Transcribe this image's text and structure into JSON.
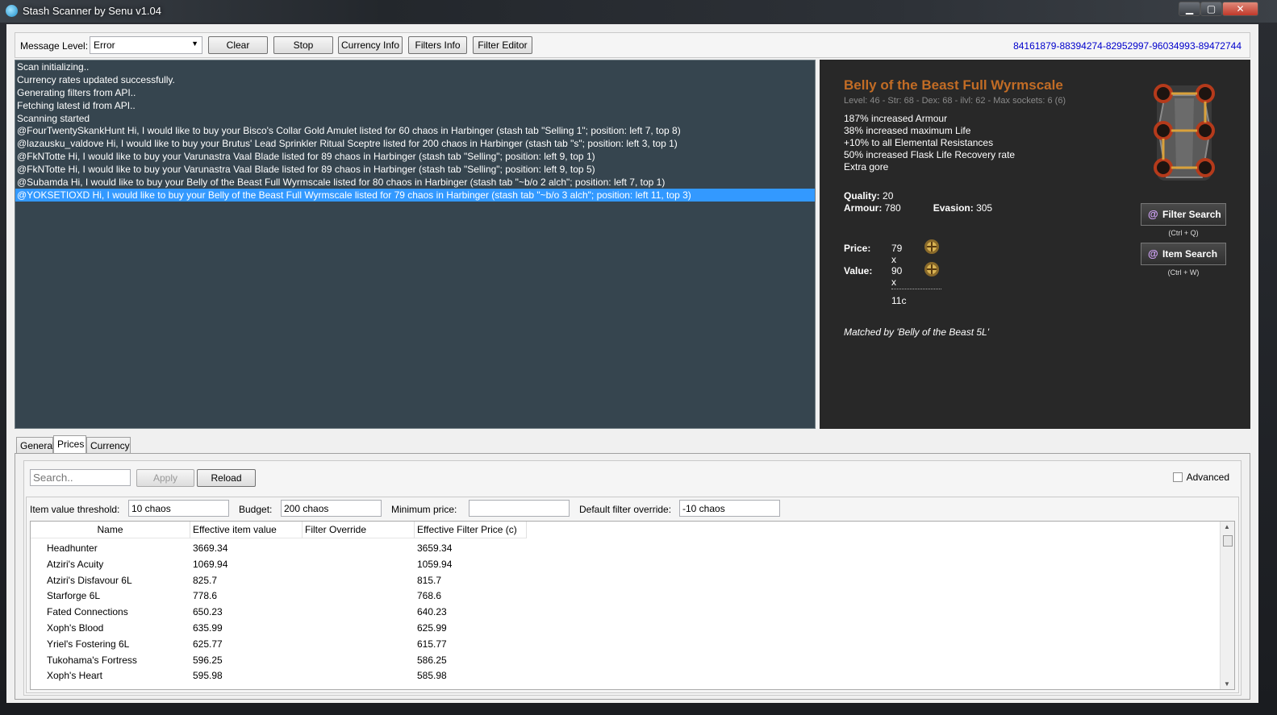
{
  "window": {
    "title": "Stash Scanner by Senu v1.04",
    "minimize": "▁",
    "maximize": "▢",
    "close": "✕"
  },
  "toolbar": {
    "message_level_label": "Message Level:",
    "message_level_value": "Error",
    "clear_label": "Clear",
    "stop_label": "Stop",
    "currency_info_label": "Currency Info",
    "filters_info_label": "Filters Info",
    "filter_editor_label": "Filter Editor",
    "change_id": "84161879-88394274-82952997-96034993-89472744"
  },
  "log": {
    "lines": [
      "Scan initializing..",
      "Currency rates updated successfully.",
      "Generating filters from API..",
      "Fetching latest id from API..",
      "Scanning started",
      "@FourTwentySkankHunt Hi, I would like to buy your Bisco's Collar Gold Amulet listed for 60 chaos in Harbinger (stash tab \"Selling 1\"; position: left 7, top 8)",
      "@lazausku_valdove Hi, I would like to buy your Brutus' Lead Sprinkler Ritual Sceptre listed for 200 chaos in Harbinger (stash tab \"s\"; position: left 3, top 1)",
      "@FkNTotte Hi, I would like to buy your Varunastra Vaal Blade listed for 89 chaos in Harbinger (stash tab \"Selling\"; position: left 9, top 1)",
      "@FkNTotte Hi, I would like to buy your Varunastra Vaal Blade listed for 89 chaos in Harbinger (stash tab \"Selling\"; position: left 9, top 5)",
      "@Subamda Hi, I would like to buy your Belly of the Beast Full Wyrmscale listed for 80 chaos in Harbinger (stash tab \"~b/o 2 alch\"; position: left 7, top 1)",
      "@YOKSETIOXD Hi, I would like to buy your Belly of the Beast Full Wyrmscale listed for 79 chaos in Harbinger (stash tab \"~b/o 3 alch\"; position: left 11, top 3)"
    ]
  },
  "item": {
    "name": "Belly of the Beast Full Wyrmscale",
    "name_color": "#c26c25",
    "meta": "Level: 46 - Str: 68 - Dex: 68 - ilvl: 62 - Max sockets: 6 (6)",
    "mods": [
      "187% increased Armour",
      "38% increased maximum Life",
      "+10% to all Elemental Resistances",
      "50% increased Flask Life Recovery rate",
      "Extra gore"
    ],
    "quality_key": "Quality:",
    "quality_val": "20",
    "armour_key": "Armour:",
    "armour_val": "780",
    "evasion_key": "Evasion:",
    "evasion_val": "305",
    "price_key": "Price:",
    "price_val": "79 x",
    "value_key": "Value:",
    "value_val": "90 x",
    "diff": "11c",
    "matched_by": "Matched by 'Belly of the Beast 5L'",
    "filter_search_label": "Filter Search",
    "filter_search_shortcut": "(Ctrl + Q)",
    "item_search_label": "Item Search",
    "item_search_shortcut": "(Ctrl + W)",
    "image_icon": "body-armour-6-socket-icon",
    "currency_icon": "chaos-orb-icon"
  },
  "tabs": {
    "general": "General",
    "prices": "Prices",
    "currency": "Currency",
    "active": "prices"
  },
  "prices": {
    "search_placeholder": "Search..",
    "apply_label": "Apply",
    "reload_label": "Reload",
    "advanced_label": "Advanced",
    "threshold_label": "Item value threshold:",
    "threshold_value": "10 chaos",
    "budget_label": "Budget:",
    "budget_value": "200 chaos",
    "min_price_label": "Minimum price:",
    "min_price_value": "",
    "default_override_label": "Default filter override:",
    "default_override_value": "-10 chaos",
    "columns": [
      "Name",
      "Effective item value",
      "Filter Override",
      "Effective Filter Price (c)"
    ],
    "rows": [
      [
        "Headhunter",
        "3669.34",
        "",
        "3659.34"
      ],
      [
        "Atziri's Acuity",
        "1069.94",
        "",
        "1059.94"
      ],
      [
        "Atziri's Disfavour 6L",
        "825.7",
        "",
        "815.7"
      ],
      [
        "Starforge 6L",
        "778.6",
        "",
        "768.6"
      ],
      [
        "Fated Connections",
        "650.23",
        "",
        "640.23"
      ],
      [
        "Xoph's Blood",
        "635.99",
        "",
        "625.99"
      ],
      [
        "Yriel's Fostering 6L",
        "625.77",
        "",
        "615.77"
      ],
      [
        "Tukohama's Fortress",
        "596.25",
        "",
        "586.25"
      ],
      [
        "Xoph's Heart",
        "595.98",
        "",
        "585.98"
      ]
    ]
  }
}
